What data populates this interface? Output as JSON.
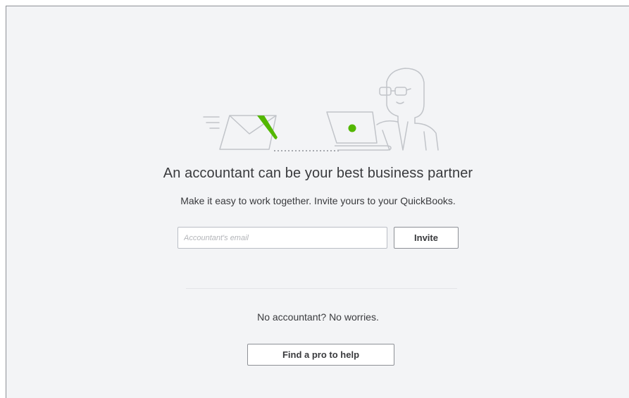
{
  "illustration": {
    "name": "accountant-invite-illustration",
    "accent_color": "#53b700",
    "line_color": "#c1c4c9"
  },
  "headline": "An accountant can be your best business partner",
  "subtext": "Make it easy to work together. Invite yours to your QuickBooks.",
  "invite_form": {
    "email_placeholder": "Accountant's email",
    "email_value": "",
    "invite_label": "Invite"
  },
  "no_accountant": {
    "text": "No accountant? No worries.",
    "find_pro_label": "Find a pro to help"
  }
}
